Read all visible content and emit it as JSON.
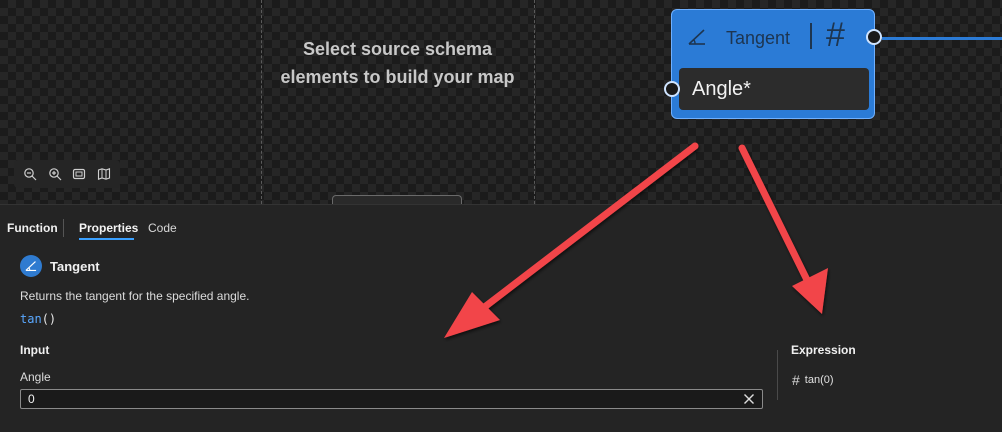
{
  "canvas": {
    "placeholder_text": "Select source schema elements to build your map",
    "zoom_toolbar": {
      "icons": [
        "zoom-out-icon",
        "zoom-in-icon",
        "fit-view-icon",
        "minimap-icon"
      ]
    }
  },
  "node": {
    "title": "Tangent",
    "icon": "angle-icon",
    "output_type_glyph": "#",
    "input_label": "Angle*"
  },
  "panel": {
    "tabs": {
      "section_label": "Function",
      "properties": "Properties",
      "code": "Code",
      "active": "Properties"
    },
    "function": {
      "name": "Tangent",
      "description": "Returns the tangent for the specified angle.",
      "signature_name": "tan",
      "signature_parens": "()"
    },
    "input": {
      "heading": "Input",
      "angle_label": "Angle",
      "angle_value": "0"
    },
    "expression": {
      "heading": "Expression",
      "glyph": "#",
      "value": "tan(0)"
    }
  },
  "colors": {
    "node_blue": "#2b7bd6",
    "accent_blue": "#3aa0ff",
    "arrow_red": "#f2454a"
  }
}
